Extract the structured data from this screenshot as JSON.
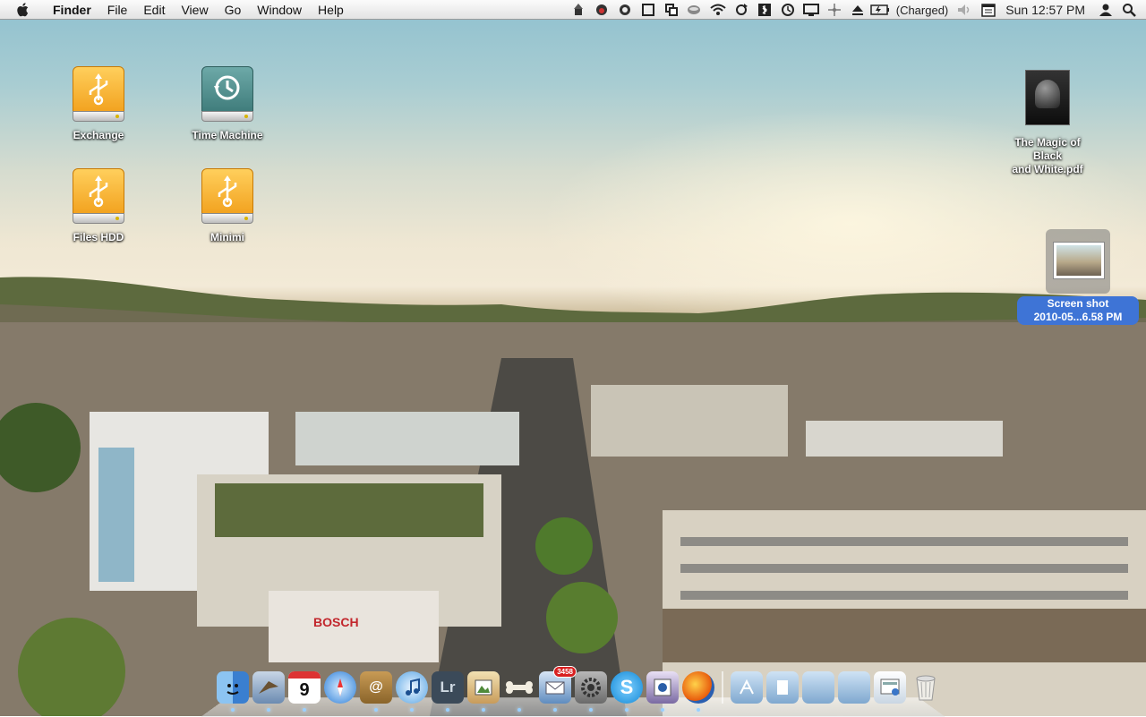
{
  "menubar": {
    "app_name": "Finder",
    "menus": [
      "File",
      "Edit",
      "View",
      "Go",
      "Window",
      "Help"
    ],
    "status_icons": [
      "wizard-icon",
      "monkey-icon",
      "quicksilver-icon",
      "square-icon",
      "copy-icon",
      "teacup-icon",
      "wifi-icon",
      "sync-icon",
      "bluetooth-panel-icon",
      "time-machine-icon",
      "display-icon",
      "move-icon",
      "eject-icon",
      "battery-icon",
      "volume-icon",
      "calendar-icon",
      "user-icon",
      "spotlight-icon"
    ],
    "battery_text": "(Charged)",
    "clock": "Sun 12:57 PM"
  },
  "desktop": {
    "icons": [
      {
        "label": "Exchange",
        "kind": "usb-drive",
        "color": "#f5a623"
      },
      {
        "label": "Time Machine",
        "kind": "time-machine-drive",
        "color": "#4f8f8e"
      },
      {
        "label": "Files HDD",
        "kind": "usb-drive",
        "color": "#f5a623"
      },
      {
        "label": "Minimi",
        "kind": "usb-drive",
        "color": "#f5a623"
      }
    ],
    "pdf": {
      "label_line1": "The Magic of Black",
      "label_line2": "and White.pdf"
    },
    "screenshot": {
      "label_line1": "Screen shot",
      "label_line2": "2010-05...6.58 PM"
    }
  },
  "dock": {
    "calendar_day": "9",
    "mail_badge": "3458",
    "lightroom_label": "Lr",
    "apps": [
      "finder-icon",
      "mail-icon",
      "calendar-icon",
      "safari-icon",
      "address-book-icon",
      "itunes-icon",
      "lightroom-icon",
      "preview-icon",
      "dog-bone-icon",
      "mail-badge-icon",
      "system-preferences-icon",
      "skype-icon",
      "photos-icon",
      "firefox-icon"
    ],
    "stacks": [
      "applications-folder-icon",
      "documents-folder-icon",
      "downloads-folder-icon",
      "folder-icon",
      "web-page-icon",
      "trash-icon"
    ]
  }
}
